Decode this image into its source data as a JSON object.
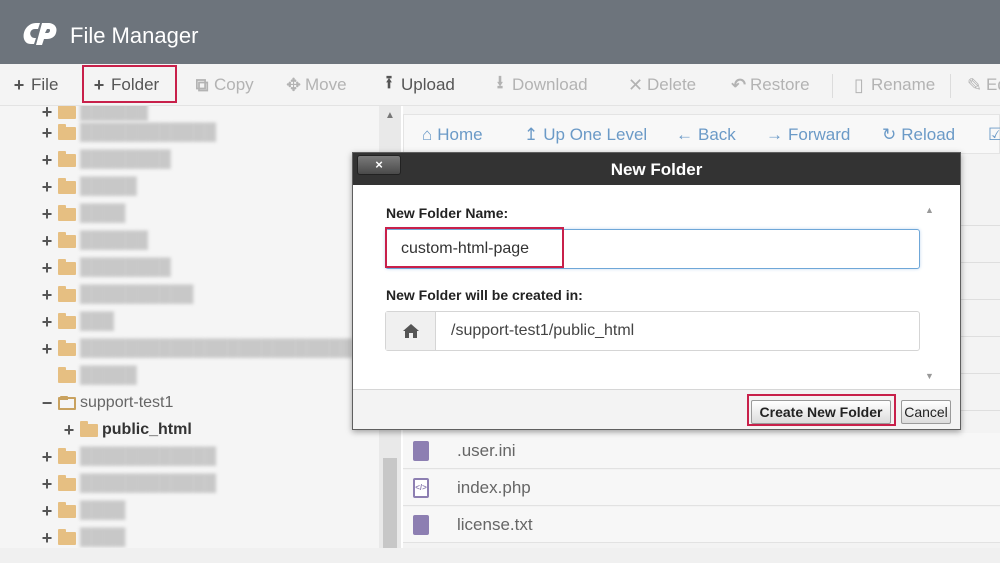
{
  "app": {
    "title": "File Manager"
  },
  "colors": {
    "header_bg": "#6d747c",
    "accent_link": "#6b9ac7",
    "highlight": "#c8204a",
    "folder": "#e6bf82",
    "dialog_titlebar": "#333333"
  },
  "toolbar": {
    "file": "File",
    "folder": "Folder",
    "copy": "Copy",
    "move": "Move",
    "upload": "Upload",
    "download": "Download",
    "delete": "Delete",
    "restore": "Restore",
    "rename": "Rename",
    "edit": "Ed"
  },
  "tree": {
    "expanded_folder": "support-test1",
    "child_folder": "public_html"
  },
  "nav": {
    "home": "Home",
    "up_one_level": "Up One Level",
    "back": "Back",
    "forward": "Forward",
    "reload": "Reload"
  },
  "files": [
    {
      "name": ".user.ini",
      "icon": "text-file-icon"
    },
    {
      "name": "index.php",
      "icon": "code-file-icon"
    },
    {
      "name": "license.txt",
      "icon": "text-file-icon"
    }
  ],
  "dialog": {
    "title": "New Folder",
    "close": "×",
    "name_label": "New Folder Name:",
    "name_value": "custom-html-page",
    "location_label": "New Folder will be created in:",
    "location_value": "/support-test1/public_html",
    "create_button": "Create New Folder",
    "cancel_button": "Cancel"
  }
}
